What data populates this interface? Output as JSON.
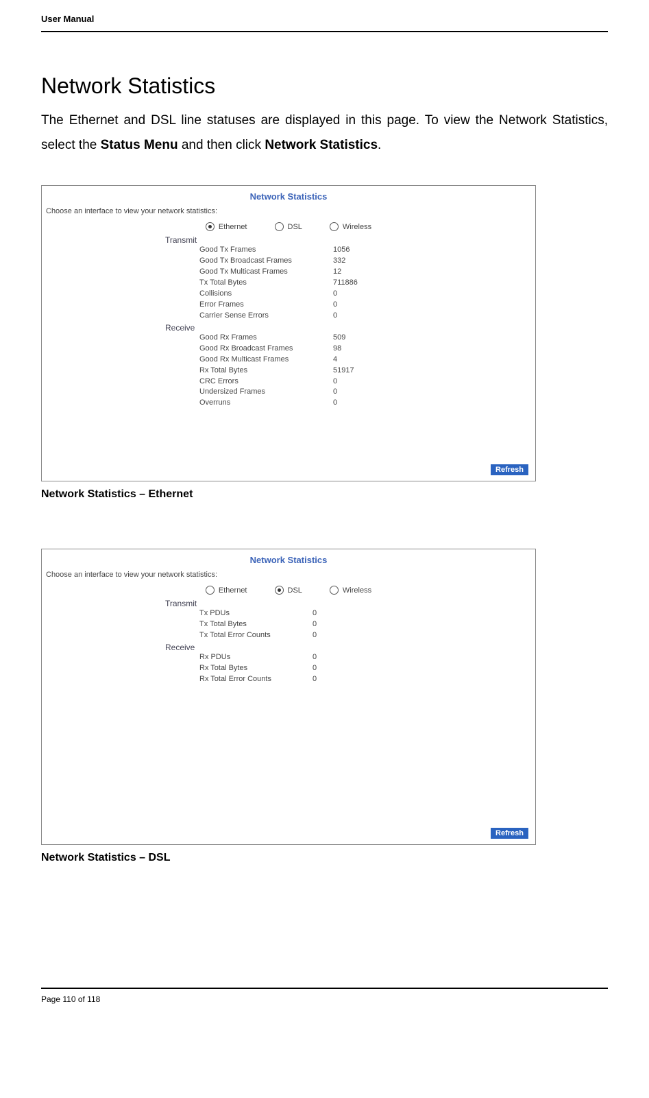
{
  "header": {
    "title": "User Manual"
  },
  "section_title": "Network Statistics",
  "body": {
    "pre": "The Ethernet and DSL line statuses are displayed in this page. To view the Network Statistics, select the ",
    "bold1": "Status Menu",
    "mid": " and then click ",
    "bold2": "Network Statistics",
    "post": "."
  },
  "screenshot1": {
    "title": "Network Statistics",
    "subtitle": "Choose an interface to view your network statistics:",
    "radios": [
      {
        "label": "Ethernet",
        "selected": true
      },
      {
        "label": "DSL",
        "selected": false
      },
      {
        "label": "Wireless",
        "selected": false
      }
    ],
    "groups": [
      {
        "name": "Transmit",
        "rows": [
          {
            "label": "Good Tx Frames",
            "value": "1056"
          },
          {
            "label": "Good Tx Broadcast Frames",
            "value": "332"
          },
          {
            "label": "Good Tx Multicast Frames",
            "value": "12"
          },
          {
            "label": "Tx Total Bytes",
            "value": "711886"
          },
          {
            "label": "Collisions",
            "value": "0"
          },
          {
            "label": "Error Frames",
            "value": "0"
          },
          {
            "label": "Carrier Sense Errors",
            "value": "0"
          }
        ]
      },
      {
        "name": "Receive",
        "rows": [
          {
            "label": "Good Rx Frames",
            "value": "509"
          },
          {
            "label": "Good Rx Broadcast Frames",
            "value": "98"
          },
          {
            "label": "Good Rx Multicast Frames",
            "value": "4"
          },
          {
            "label": "Rx Total Bytes",
            "value": "51917"
          },
          {
            "label": "CRC Errors",
            "value": "0"
          },
          {
            "label": "Undersized Frames",
            "value": "0"
          },
          {
            "label": "Overruns",
            "value": "0"
          }
        ]
      }
    ],
    "refresh": "Refresh"
  },
  "caption1": "Network Statistics – Ethernet",
  "screenshot2": {
    "title": "Network Statistics",
    "subtitle": "Choose an interface to view your network statistics:",
    "radios": [
      {
        "label": "Ethernet",
        "selected": false
      },
      {
        "label": "DSL",
        "selected": true
      },
      {
        "label": "Wireless",
        "selected": false
      }
    ],
    "groups": [
      {
        "name": "Transmit",
        "rows": [
          {
            "label": "Tx PDUs",
            "value": "0"
          },
          {
            "label": "Tx Total Bytes",
            "value": "0"
          },
          {
            "label": "Tx Total Error Counts",
            "value": "0"
          }
        ]
      },
      {
        "name": "Receive",
        "rows": [
          {
            "label": "Rx PDUs",
            "value": "0"
          },
          {
            "label": "Rx Total Bytes",
            "value": "0"
          },
          {
            "label": "Rx Total Error Counts",
            "value": "0"
          }
        ]
      }
    ],
    "refresh": "Refresh"
  },
  "caption2": "Network Statistics – DSL",
  "footer": {
    "text": "Page 110 of 118"
  }
}
